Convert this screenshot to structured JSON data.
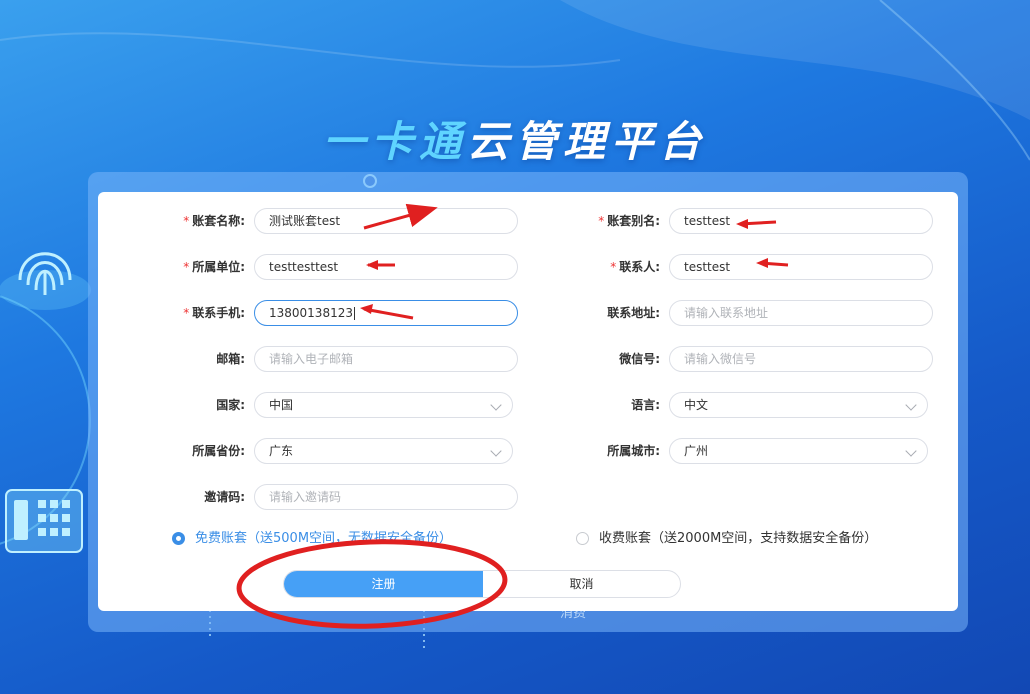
{
  "app": {
    "title_accent": "一卡通",
    "title_rest": "云管理平台"
  },
  "form": {
    "fields": [
      {
        "label": "账套名称:",
        "required": true,
        "value": "测试账套test"
      },
      {
        "label": "账套别名:",
        "required": true,
        "value": "testtest"
      },
      {
        "label": "所属单位:",
        "required": true,
        "value": "testtesttest"
      },
      {
        "label": "联系人:",
        "required": true,
        "value": "testtest"
      },
      {
        "label": "联系手机:",
        "required": true,
        "value": "13800138123"
      },
      {
        "label": "联系地址:",
        "required": false,
        "placeholder": "请输入联系地址"
      },
      {
        "label": "邮箱:",
        "required": false,
        "placeholder": "请输入电子邮箱"
      },
      {
        "label": "微信号:",
        "required": false,
        "placeholder": "请输入微信号"
      },
      {
        "label": "国家:",
        "required": false,
        "value": "中国"
      },
      {
        "label": "语言:",
        "required": false,
        "value": "中文"
      },
      {
        "label": "所属省份:",
        "required": false,
        "value": "广东"
      },
      {
        "label": "所属城市:",
        "required": false,
        "value": "广州"
      },
      {
        "label": "邀请码:",
        "required": false,
        "placeholder": "请输入邀请码"
      }
    ],
    "plan_free": "免费账套（送500M空间，无数据安全备份）",
    "plan_paid": "收费账套（送2000M空间，支持数据安全备份）",
    "register_label": "注册",
    "cancel_label": "取消",
    "required_mark": "*"
  },
  "background": {
    "under_text": "消费"
  },
  "colors": {
    "accent": "#46a0f6",
    "annotation": "#e02020",
    "title_accent": "#5fd4ff"
  }
}
